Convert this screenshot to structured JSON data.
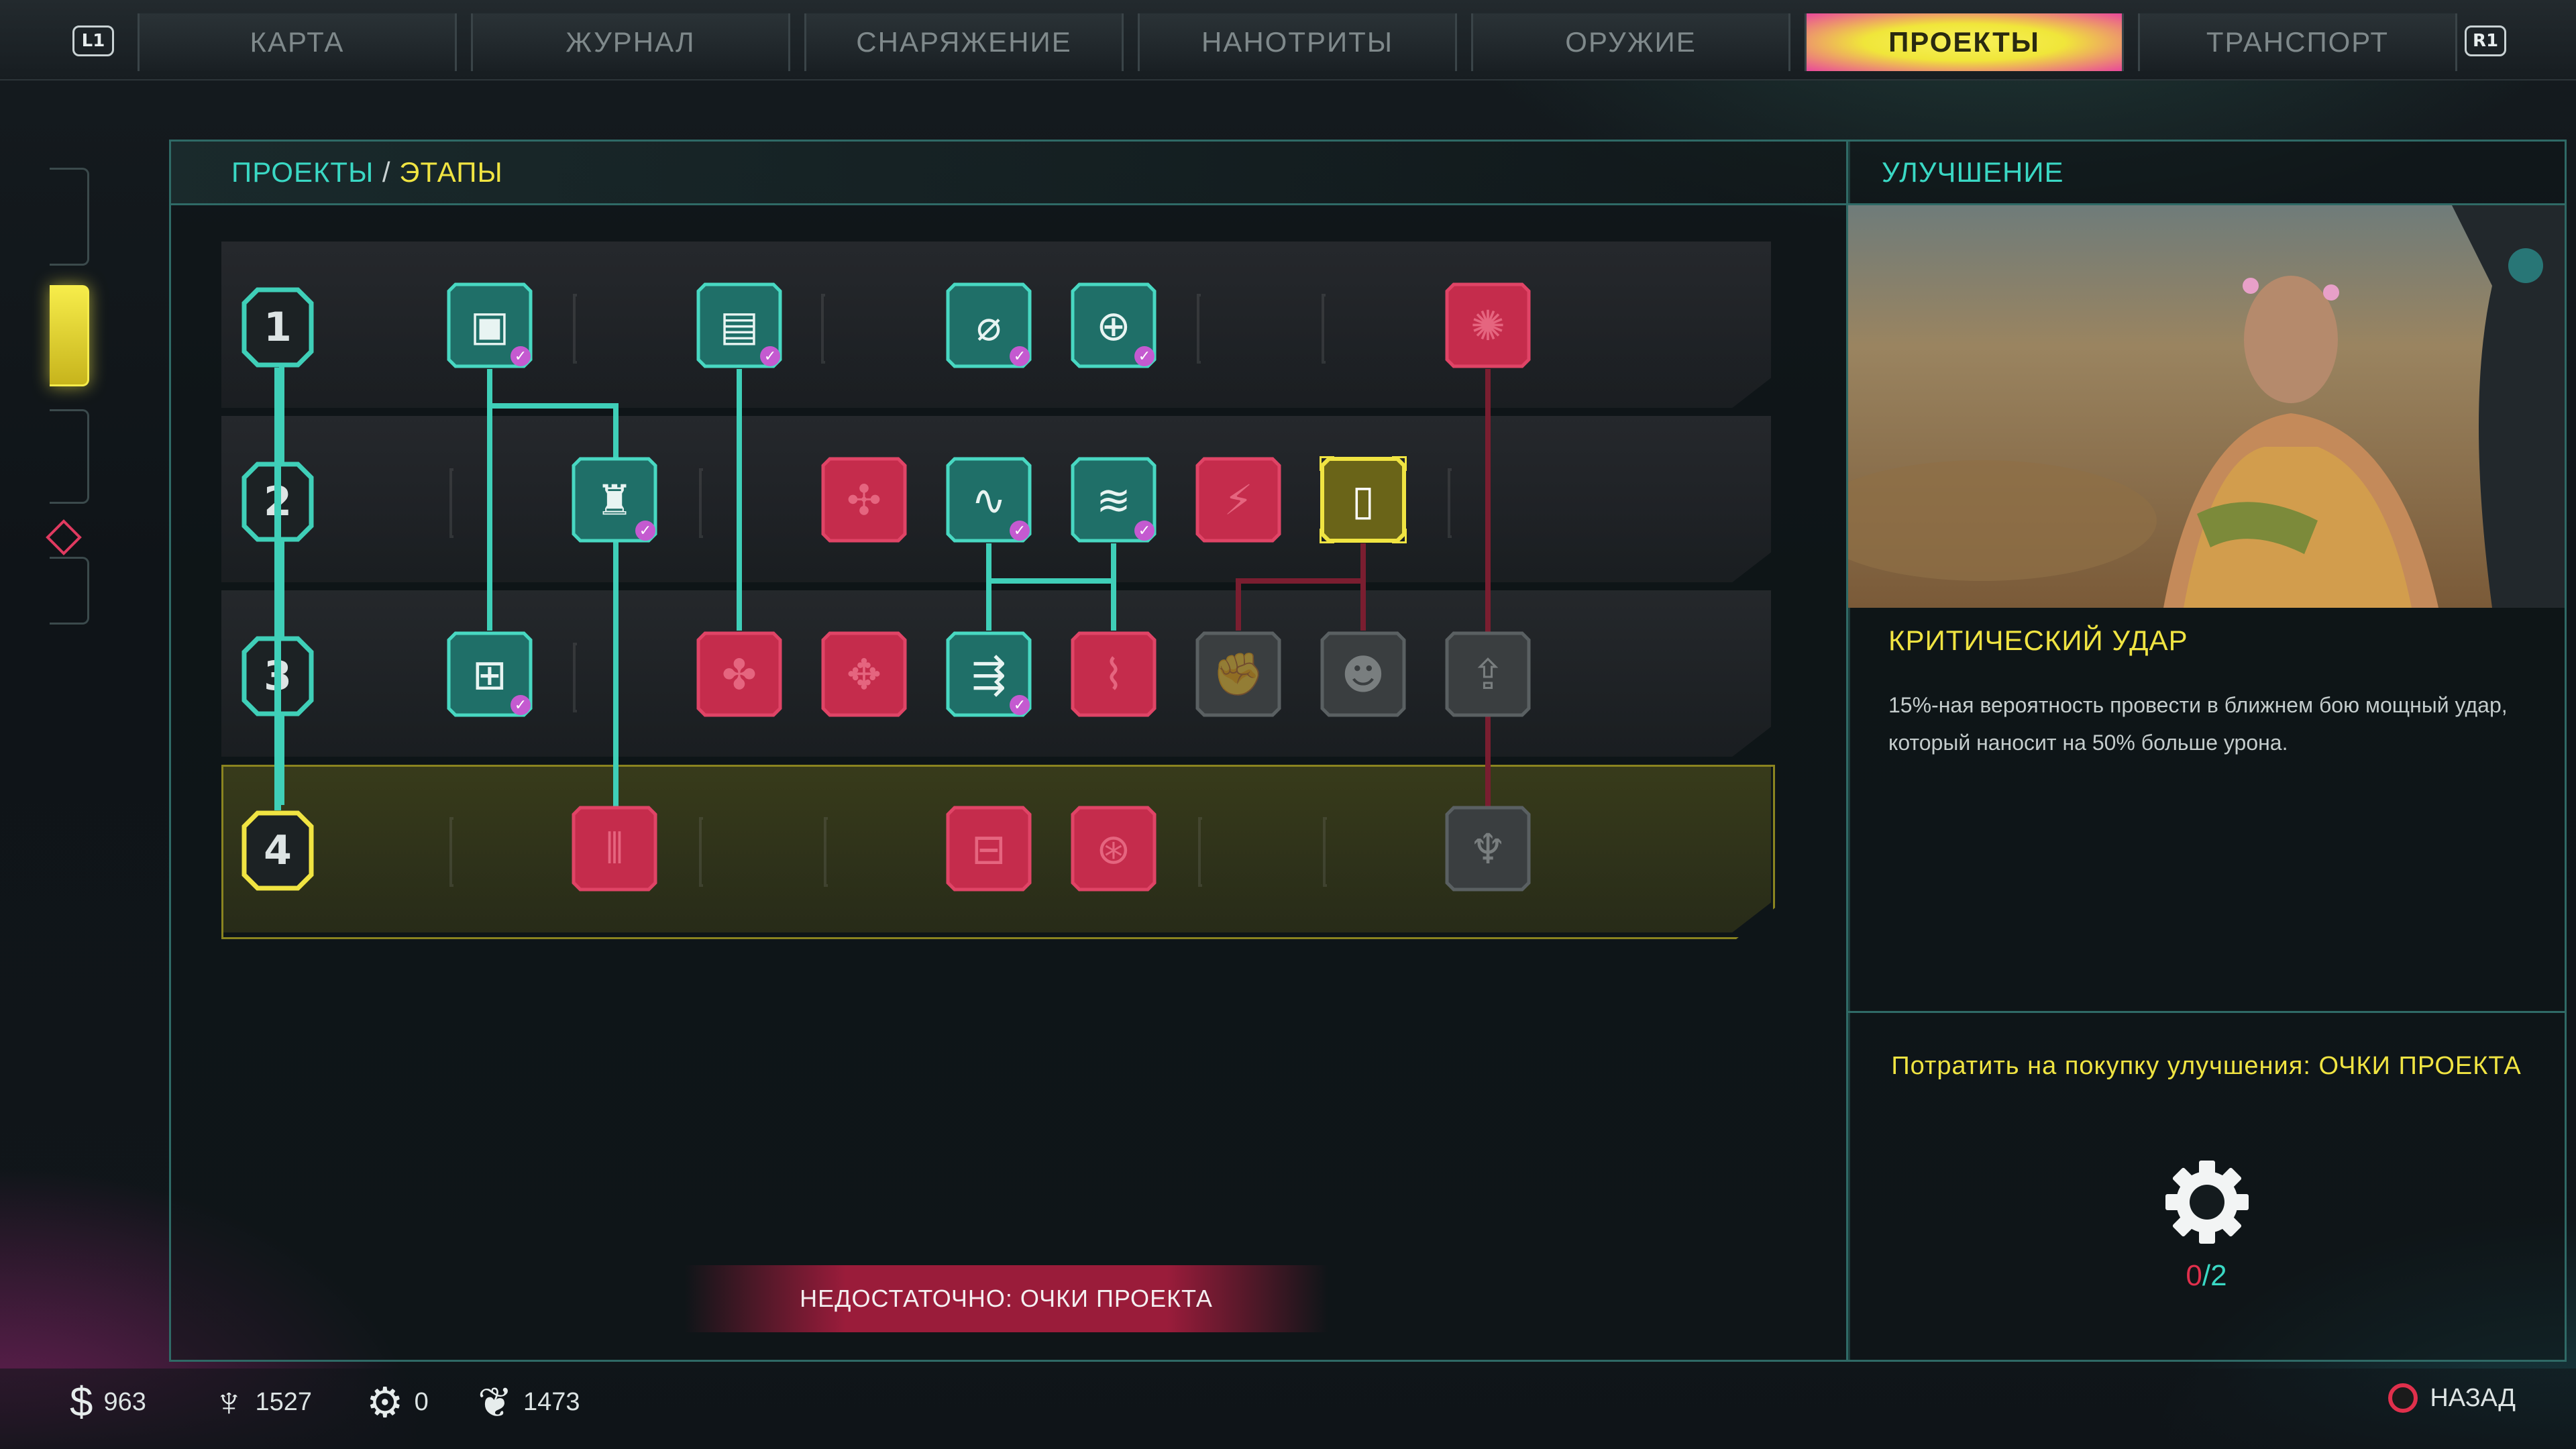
{
  "topbar": {
    "left_shoulder": "L1",
    "right_shoulder": "R1",
    "tabs": [
      {
        "label": "КАРТА"
      },
      {
        "label": "ЖУРНАЛ"
      },
      {
        "label": "СНАРЯЖЕНИЕ"
      },
      {
        "label": "НАНОТРИТЫ"
      },
      {
        "label": "ОРУЖИЕ"
      },
      {
        "label": "ПРОЕКТЫ",
        "active": true
      },
      {
        "label": "ТРАНСПОРТ"
      }
    ]
  },
  "main": {
    "breadcrumb": {
      "section": "ПРОЕКТЫ",
      "separator": " / ",
      "page": "ЭТАПЫ"
    },
    "stages": [
      "1",
      "2",
      "3",
      "4"
    ],
    "current_stage": "4",
    "warning": "НЕДОСТАТОЧНО: ОЧКИ ПРОЕКТА"
  },
  "side": {
    "header": "УЛУЧШЕНИЕ",
    "upgrade_title": "КРИТИЧЕСКИЙ УДАР",
    "upgrade_description": "15%-ная вероятность провести в ближнем бою мощный удар, который наносит на 50% больше урона.",
    "spend_label": "Потратить на покупку улучшения: ОЧКИ ПРОЕКТА",
    "points_have": "0",
    "points_separator": "/",
    "points_need": "2"
  },
  "resources": [
    {
      "icon": "dollar-icon",
      "value": "963"
    },
    {
      "icon": "feltrite-icon",
      "value": "1527"
    },
    {
      "icon": "gear-icon",
      "value": "0"
    },
    {
      "icon": "wings-icon",
      "value": "1473"
    }
  ],
  "back_button": {
    "label": "НАЗАД"
  },
  "colors": {
    "accent_teal": "#3ad8c4",
    "accent_yellow": "#f0e442",
    "locked_red": "#d8365a",
    "tab_active_pink": "#e9479c"
  }
}
